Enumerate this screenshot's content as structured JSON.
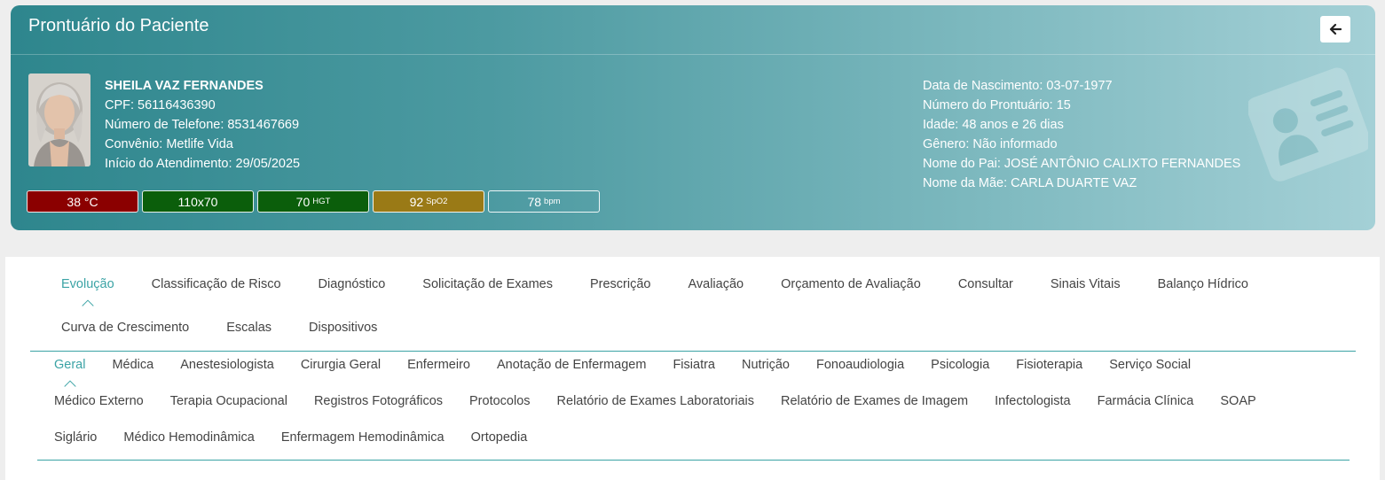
{
  "header": {
    "title": "Prontuário do Paciente"
  },
  "patient": {
    "name": "SHEILA VAZ FERNANDES",
    "cpf": "CPF: 56116436390",
    "phone": "Número de Telefone: 8531467669",
    "insurance": "Convênio: Metlife Vida",
    "start": "Início do Atendimento: 29/05/2025",
    "birth": "Data de Nascimento: 03-07-1977",
    "record_number": "Número do Prontuário: 15",
    "age": "Idade: 48 anos e 26 dias",
    "gender": "Gênero: Não informado",
    "father": "Nome do Pai: JOSÉ ANTÔNIO CALIXTO FERNANDES",
    "mother": "Nome da Mãe: CARLA DUARTE VAZ"
  },
  "vitals": [
    {
      "value": "38 °C",
      "unit": "",
      "color": "#8b0000"
    },
    {
      "value": "110x70",
      "unit": "",
      "color": "#0b5e0b"
    },
    {
      "value": "70",
      "unit": "HGT",
      "color": "#0b5e0b"
    },
    {
      "value": "92",
      "unit": "SpO2",
      "color": "#9a7a16"
    },
    {
      "value": "78",
      "unit": "bpm",
      "color": "transparent"
    }
  ],
  "main_tabs": {
    "row1": [
      "Evolução",
      "Classificação de Risco",
      "Diagnóstico",
      "Solicitação de Exames",
      "Prescrição",
      "Avaliação",
      "Orçamento de Avaliação",
      "Consultar",
      "Sinais Vitais",
      "Balanço Hídrico"
    ],
    "row2": [
      "Curva de Crescimento",
      "Escalas",
      "Dispositivos"
    ],
    "active": "Evolução"
  },
  "sub_tabs": {
    "row1": [
      "Geral",
      "Médica",
      "Anestesiologista",
      "Cirurgia Geral",
      "Enfermeiro",
      "Anotação de Enfermagem",
      "Fisiatra",
      "Nutrição",
      "Fonoaudiologia",
      "Psicologia",
      "Fisioterapia",
      "Serviço Social"
    ],
    "row2": [
      "Médico Externo",
      "Terapia Ocupacional",
      "Registros Fotográficos",
      "Protocolos",
      "Relatório de Exames Laboratoriais",
      "Relatório de Exames de Imagem",
      "Infectologista",
      "Farmácia Clínica",
      "SOAP"
    ],
    "row3": [
      "Siglário",
      "Médico Hemodinâmica",
      "Enfermagem Hemodinâmica",
      "Ortopedia"
    ],
    "active": "Geral"
  },
  "colors": {
    "accent": "#3ba3a5",
    "header_start": "#2e868d",
    "header_end": "#a4d0d6"
  }
}
